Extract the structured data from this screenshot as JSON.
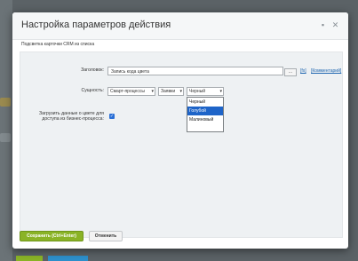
{
  "dialog": {
    "title": "Настройка параметров действия",
    "subtitle": "Подсветка карточки CRM из списка"
  },
  "form": {
    "title_label": "Заголовок:",
    "title_value": "Запись кода цвета",
    "dots_label": "...",
    "link_fx": "[fx]",
    "link_comment": "[Комментарий]",
    "entity_label": "Сущность:",
    "entity_selects": [
      "Смарт-процессы",
      "Заявки",
      "Черный"
    ],
    "dropdown_options": [
      "Черный",
      "Голубой",
      "Малиновый"
    ],
    "dropdown_highlighted": "Голубой",
    "load_label_line1": "Загрузить данные о цвете для",
    "load_label_line2": "доступа из бизнес-процесса:",
    "load_checked": true
  },
  "footer": {
    "save_label": "Сохранить (Ctrl+Enter)",
    "cancel_label": "Отменить"
  },
  "colors": {
    "accent": "#8ab326",
    "link": "#2067b0",
    "highlight": "#1e64c8"
  }
}
